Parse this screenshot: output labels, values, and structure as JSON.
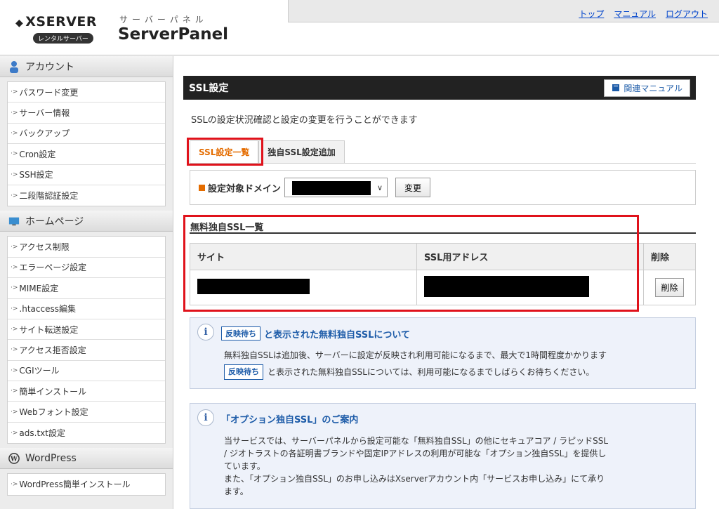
{
  "header": {
    "brand": "XSERVER",
    "brand_badge": "レンタルサーバー",
    "panel_kana": "サーバーパネル",
    "panel_title": "ServerPanel",
    "nav": {
      "top": "トップ",
      "manual": "マニュアル",
      "logout": "ログアウト"
    }
  },
  "sidebar": {
    "sections": [
      {
        "title": "アカウント",
        "icon": "user-icon",
        "items": [
          "パスワード変更",
          "サーバー情報",
          "バックアップ",
          "Cron設定",
          "SSH設定",
          "二段階認証設定"
        ]
      },
      {
        "title": "ホームページ",
        "icon": "monitor-icon",
        "items": [
          "アクセス制限",
          "エラーページ設定",
          "MIME設定",
          ".htaccess編集",
          "サイト転送設定",
          "アクセス拒否設定",
          "CGIツール",
          "簡単インストール",
          "Webフォント設定",
          "ads.txt設定"
        ]
      },
      {
        "title": "WordPress",
        "icon": "wordpress-icon",
        "items": [
          "WordPress簡単インストール"
        ]
      }
    ]
  },
  "main": {
    "title": "SSL設定",
    "manual_button": "関連マニュアル",
    "description": "SSLの設定状況確認と設定の変更を行うことができます",
    "tabs": [
      {
        "label": "SSL設定一覧",
        "active": true
      },
      {
        "label": "独自SSL設定追加",
        "active": false
      }
    ],
    "domain_label": "設定対象ドメイン",
    "change_button": "変更",
    "ssl_list_title": "無料独自SSL一覧",
    "table": {
      "headers": [
        "サイト",
        "SSL用アドレス",
        "削除"
      ],
      "delete_button": "削除"
    },
    "info1": {
      "tag": "反映待ち",
      "title": "と表示された無料独自SSLについて",
      "line1": "無料独自SSLは追加後、サーバーに設定が反映され利用可能になるまで、最大で1時間程度かかります",
      "line2": "と表示された無料独自SSLについては、利用可能になるまでしばらくお待ちください。"
    },
    "info2": {
      "title": "「オプション独自SSL」のご案内",
      "line1": "当サービスでは、サーバーパネルから設定可能な「無料独自SSL」の他にセキュアコア / ラピッドSSL",
      "line2": "/ ジオトラストの各証明書ブランドや固定IPアドレスの利用が可能な「オプション独自SSL」を提供し",
      "line3": "ています。",
      "line4": "また、「オプション独自SSL」のお申し込みはXserverアカウント内「サービスお申し込み」にて承り",
      "line5": "ます。"
    }
  }
}
